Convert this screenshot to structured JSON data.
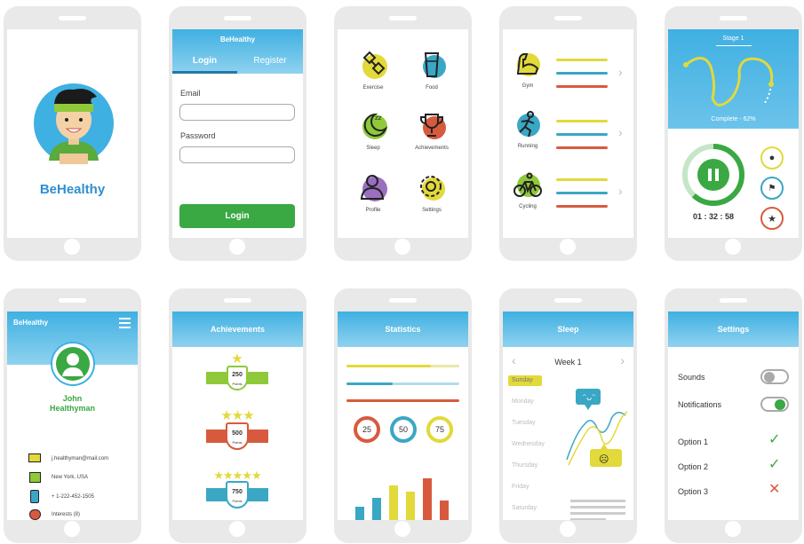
{
  "app": {
    "name": "BeHealthy"
  },
  "login": {
    "brand": "BeHealthy",
    "tab_login": "Login",
    "tab_register": "Register",
    "email_label": "Email",
    "password_label": "Password",
    "email_value": "",
    "password_value": "",
    "button": "Login"
  },
  "menu": {
    "items": [
      "Exercise",
      "Food",
      "Sleep",
      "Achievements",
      "Profile",
      "Settings"
    ]
  },
  "activities": {
    "items": [
      "Gym",
      "Running",
      "Cycling"
    ]
  },
  "workout": {
    "stage": "Stage 1",
    "complete": "Complete - 62%",
    "progress": 0.62,
    "timer": "01 : 32 : 58"
  },
  "profile": {
    "brand": "BeHealthy",
    "name_first": "John",
    "name_last": "Healthyman",
    "email": "j.healthyman@mail.com",
    "location": "New York, USA",
    "phone": "+ 1-222-452-1505",
    "interests": "Interests (8)"
  },
  "achievements": {
    "title": "Achievements",
    "badges": [
      {
        "value": "250",
        "unit": "Points",
        "stars": 1
      },
      {
        "value": "500",
        "unit": "Points",
        "stars": 3
      },
      {
        "value": "750",
        "unit": "Points",
        "stars": 5
      }
    ]
  },
  "statistics": {
    "title": "Statistics",
    "rings": [
      "25",
      "50",
      "75"
    ]
  },
  "sleep": {
    "title": "Sleep",
    "week": "Week 1",
    "days": [
      "Sunday",
      "Monday",
      "Tuesday",
      "Wednesday",
      "Thursday",
      "Friday",
      "Saturday"
    ],
    "selected": "Sunday"
  },
  "settings": {
    "title": "Settings",
    "sounds": "Sounds",
    "notifications": "Notifications",
    "sounds_on": false,
    "notifications_on": true,
    "options": [
      {
        "label": "Option 1",
        "state": "check"
      },
      {
        "label": "Option 2",
        "state": "check"
      },
      {
        "label": "Option 3",
        "state": "cross"
      }
    ]
  },
  "colors": {
    "blue": "#3fb0e2",
    "green": "#3aa843",
    "yellow": "#e2d93a",
    "red": "#d85a3e",
    "teal": "#3aa7c5",
    "purple": "#9b6fbf",
    "brand_green": "#5aaa3c",
    "brand_blue": "#2f8fd0"
  }
}
